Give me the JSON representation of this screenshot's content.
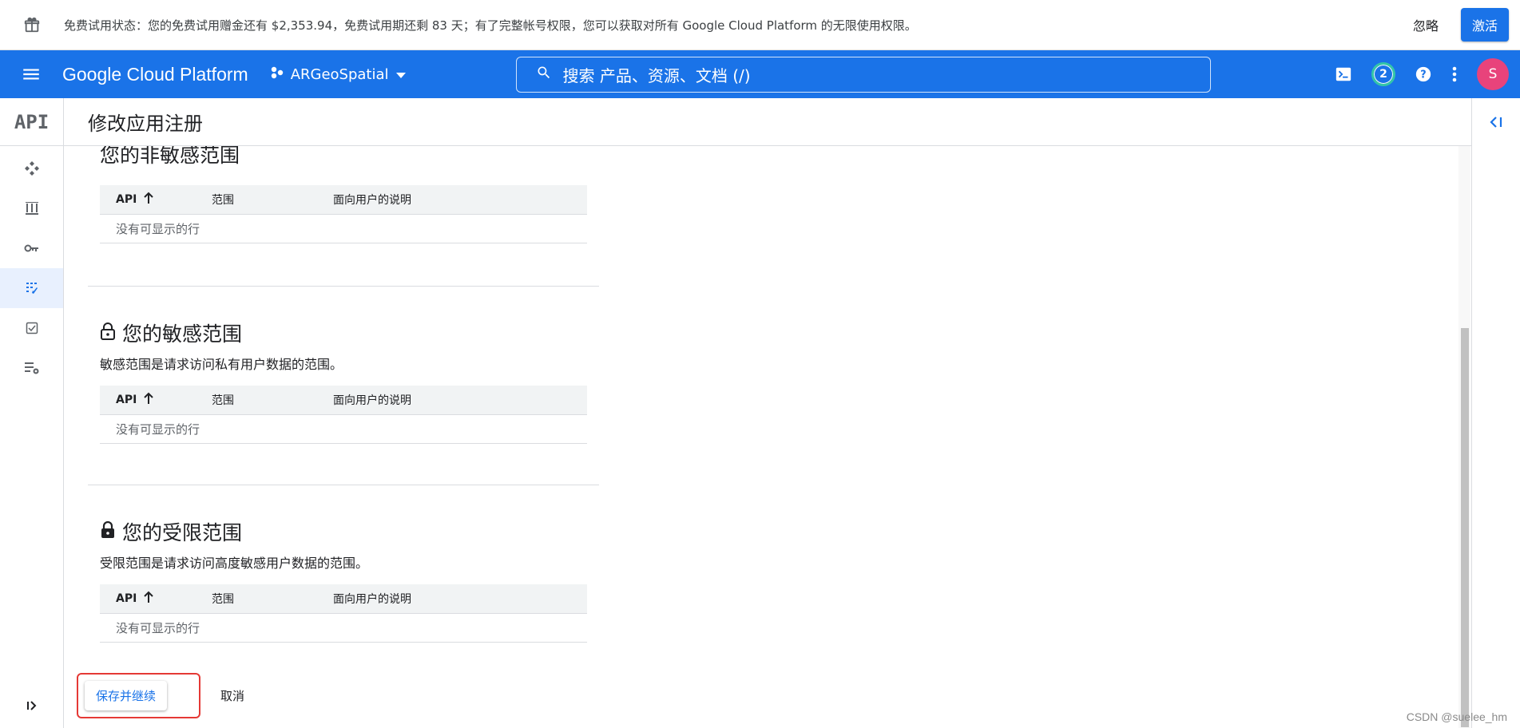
{
  "banner": {
    "message": "免费试用状态：您的免费试用赠金还有 $2,353.94，免费试用期还剩 83 天；有了完整帐号权限，您可以获取对所有 Google Cloud Platform 的无限使用权限。",
    "ignore_label": "忽略",
    "activate_label": "激活"
  },
  "appbar": {
    "brand": "Google Cloud Platform",
    "project": "ARGeoSpatial",
    "search_placeholder": "搜索  产品、资源、文档 (/)",
    "notification_count": "2",
    "avatar_initial": "S"
  },
  "rail": {
    "logo": "API"
  },
  "page": {
    "title": "修改应用注册"
  },
  "sections": [
    {
      "title": "您的非敏感范围",
      "description": "",
      "lock": "none"
    },
    {
      "title": "您的敏感范围",
      "description": "敏感范围是请求访问私有用户数据的范围。",
      "lock": "open"
    },
    {
      "title": "您的受限范围",
      "description": "受限范围是请求访问高度敏感用户数据的范围。",
      "lock": "closed"
    }
  ],
  "table": {
    "columns": [
      "API",
      "范围",
      "面向用户的说明"
    ],
    "empty_text": "没有可显示的行"
  },
  "actions": {
    "save_label": "保存并继续",
    "cancel_label": "取消"
  },
  "watermark": "CSDN @suelee_hm",
  "colors": {
    "brand_blue": "#1a73e8",
    "highlight_red": "#e53935",
    "avatar_pink": "#e8437b"
  }
}
